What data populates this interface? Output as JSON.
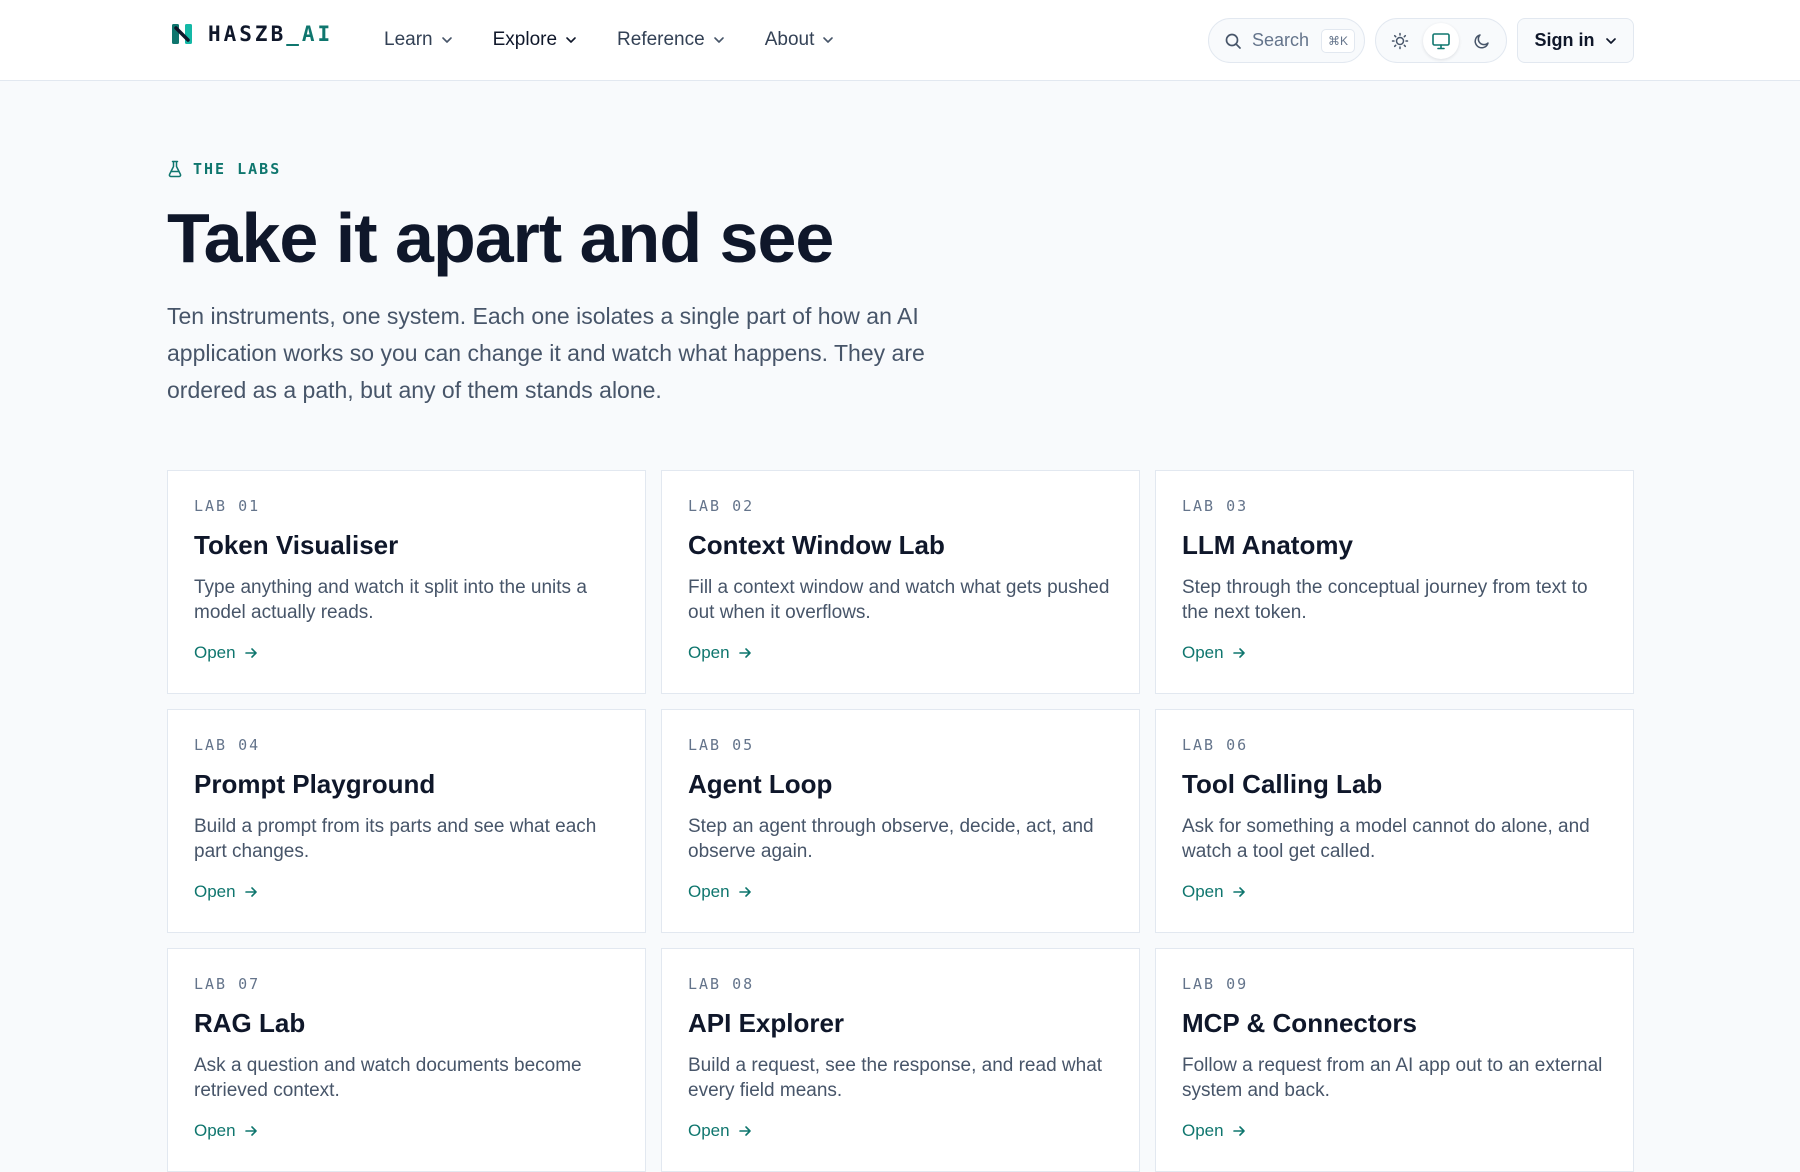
{
  "brand": {
    "name": "HASZB",
    "accent": "_AI",
    "color": "#0f766e"
  },
  "nav": {
    "items": [
      {
        "label": "Learn"
      },
      {
        "label": "Explore"
      },
      {
        "label": "Reference"
      },
      {
        "label": "About"
      }
    ]
  },
  "search": {
    "label": "Search",
    "shortcut": "⌘K"
  },
  "theme": {
    "options": [
      "light-mode-icon",
      "system-mode-icon",
      "dark-mode-icon"
    ],
    "selected": "system-mode-icon"
  },
  "signin": {
    "label": "Sign in"
  },
  "hero": {
    "eyebrow": "THE LABS",
    "title": "Take it apart and see",
    "description": "Ten instruments, one system. Each one isolates a single part of how an AI application works so you can change it and watch what happens. They are ordered as a path, but any of them stands alone."
  },
  "labs": [
    {
      "num": "LAB 01",
      "title": "Token Visualiser",
      "desc": "Type anything and watch it split into the units a model actually reads.",
      "cta": "Open"
    },
    {
      "num": "LAB 02",
      "title": "Context Window Lab",
      "desc": "Fill a context window and watch what gets pushed out when it overflows.",
      "cta": "Open"
    },
    {
      "num": "LAB 03",
      "title": "LLM Anatomy",
      "desc": "Step through the conceptual journey from text to the next token.",
      "cta": "Open"
    },
    {
      "num": "LAB 04",
      "title": "Prompt Playground",
      "desc": "Build a prompt from its parts and see what each part changes.",
      "cta": "Open"
    },
    {
      "num": "LAB 05",
      "title": "Agent Loop",
      "desc": "Step an agent through observe, decide, act, and observe again.",
      "cta": "Open"
    },
    {
      "num": "LAB 06",
      "title": "Tool Calling Lab",
      "desc": "Ask for something a model cannot do alone, and watch a tool get called.",
      "cta": "Open"
    },
    {
      "num": "LAB 07",
      "title": "RAG Lab",
      "desc": "Ask a question and watch documents become retrieved context.",
      "cta": "Open"
    },
    {
      "num": "LAB 08",
      "title": "API Explorer",
      "desc": "Build a request, see the response, and read what every field means.",
      "cta": "Open"
    },
    {
      "num": "LAB 09",
      "title": "MCP & Connectors",
      "desc": "Follow a request from an AI app out to an external system and back.",
      "cta": "Open"
    }
  ]
}
